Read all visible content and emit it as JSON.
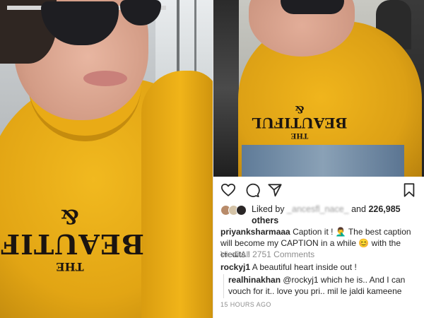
{
  "colors": {
    "sweater": "#e8a915",
    "text": "#262626",
    "muted": "#8e8e8e",
    "background": "#ffffff"
  },
  "photo": {
    "print_line1": "THE",
    "print_line2": "BEAUTIFUL",
    "print_line3": "&"
  },
  "post": {
    "actions": {
      "like_icon": "heart-icon",
      "comment_icon": "comment-icon",
      "share_icon": "share-icon",
      "save_icon": "bookmark-icon"
    },
    "likes": {
      "prefix": "Liked by",
      "hidden_user": "_ancesfl_nace_",
      "suffix": "and",
      "count": "226,985",
      "others": "others"
    },
    "caption": {
      "username": "priyanksharmaaa",
      "text": "Caption it ! 🤦‍♂️ The best caption will become my CAPTION in a while 😊 with the credits !"
    },
    "view_all": "View All 2751 Comments",
    "comments": [
      {
        "username": "rockyj1",
        "text": "A beautiful heart inside out !"
      }
    ],
    "reply": {
      "username": "realhinakhan",
      "mention": "@rockyj1",
      "text": "which he is.. And I can vouch for it.. love you pri.. mil le jaldi kameene"
    },
    "timestamp": "15 HOURS AGO"
  }
}
